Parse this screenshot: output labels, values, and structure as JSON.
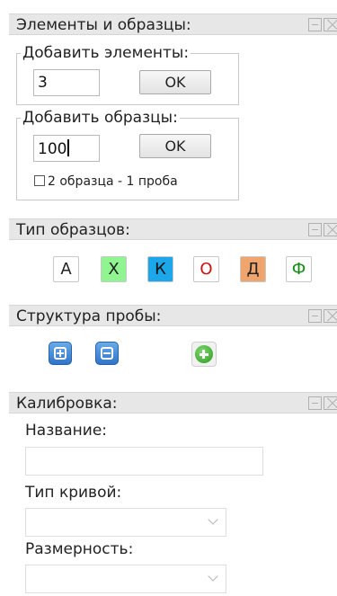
{
  "elements_panel": {
    "title": "Элементы и образцы:",
    "add_elements": {
      "legend": "Добавить элементы:",
      "value": "3",
      "ok_label": "OK"
    },
    "add_samples": {
      "legend": "Добавить образцы:",
      "value": "100",
      "ok_label": "OK",
      "checkbox_label": "2 образца - 1 проба",
      "checkbox_checked": false
    }
  },
  "sample_type_panel": {
    "title": "Тип образцов:",
    "types": [
      {
        "label": "А",
        "bg": "#ffffff",
        "color": "#222222"
      },
      {
        "label": "Х",
        "bg": "#90f590",
        "color": "#222222"
      },
      {
        "label": "К",
        "bg": "#1ca7ea",
        "color": "#111111"
      },
      {
        "label": "О",
        "bg": "#ffffff",
        "color": "#cc1111"
      },
      {
        "label": "Д",
        "bg": "#f0a56e",
        "color": "#222222"
      },
      {
        "label": "Ф",
        "bg": "#ffffff",
        "color": "#138c13"
      }
    ]
  },
  "probe_structure_panel": {
    "title": "Структура пробы:",
    "buttons": [
      "expand-icon",
      "collapse-icon",
      "add-icon"
    ]
  },
  "calibration_panel": {
    "title": "Калибровка:",
    "name_label": "Название:",
    "name_value": "",
    "curve_type_label": "Тип кривой:",
    "curve_type_value": "",
    "dimension_label": "Размерность:",
    "dimension_value": ""
  }
}
